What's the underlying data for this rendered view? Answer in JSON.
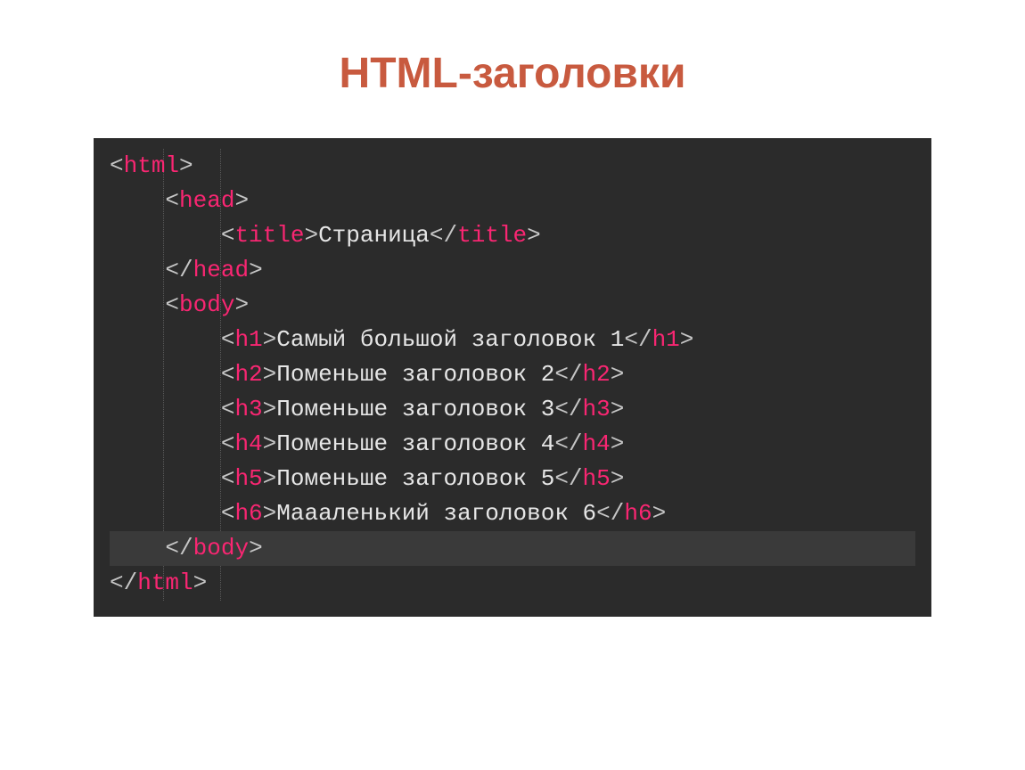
{
  "slide": {
    "title": "HTML-заголовки"
  },
  "code": {
    "lines": [
      {
        "indent": 0,
        "open": "html",
        "text": null,
        "close": null,
        "leading_close": false
      },
      {
        "indent": 1,
        "open": "head",
        "text": null,
        "close": null,
        "leading_close": false
      },
      {
        "indent": 2,
        "open": "title",
        "text": "Страница",
        "close": "title",
        "leading_close": false
      },
      {
        "indent": 1,
        "open": "head",
        "text": null,
        "close": null,
        "leading_close": true
      },
      {
        "indent": 1,
        "open": "body",
        "text": null,
        "close": null,
        "leading_close": false
      },
      {
        "indent": 2,
        "open": "h1",
        "text": "Самый большой заголовок 1",
        "close": "h1",
        "leading_close": false
      },
      {
        "indent": 2,
        "open": "h2",
        "text": "Поменьше заголовок 2",
        "close": "h2",
        "leading_close": false
      },
      {
        "indent": 2,
        "open": "h3",
        "text": "Поменьше заголовок 3",
        "close": "h3",
        "leading_close": false
      },
      {
        "indent": 2,
        "open": "h4",
        "text": "Поменьше заголовок 4",
        "close": "h4",
        "leading_close": false
      },
      {
        "indent": 2,
        "open": "h5",
        "text": "Поменьше заголовок 5",
        "close": "h5",
        "leading_close": false
      },
      {
        "indent": 2,
        "open": "h6",
        "text": "Маааленький заголовок 6",
        "close": "h6",
        "leading_close": false
      },
      {
        "indent": 1,
        "open": "body",
        "text": null,
        "close": null,
        "leading_close": true,
        "highlight": true
      },
      {
        "indent": 0,
        "open": "html",
        "text": null,
        "close": null,
        "leading_close": true
      }
    ]
  }
}
